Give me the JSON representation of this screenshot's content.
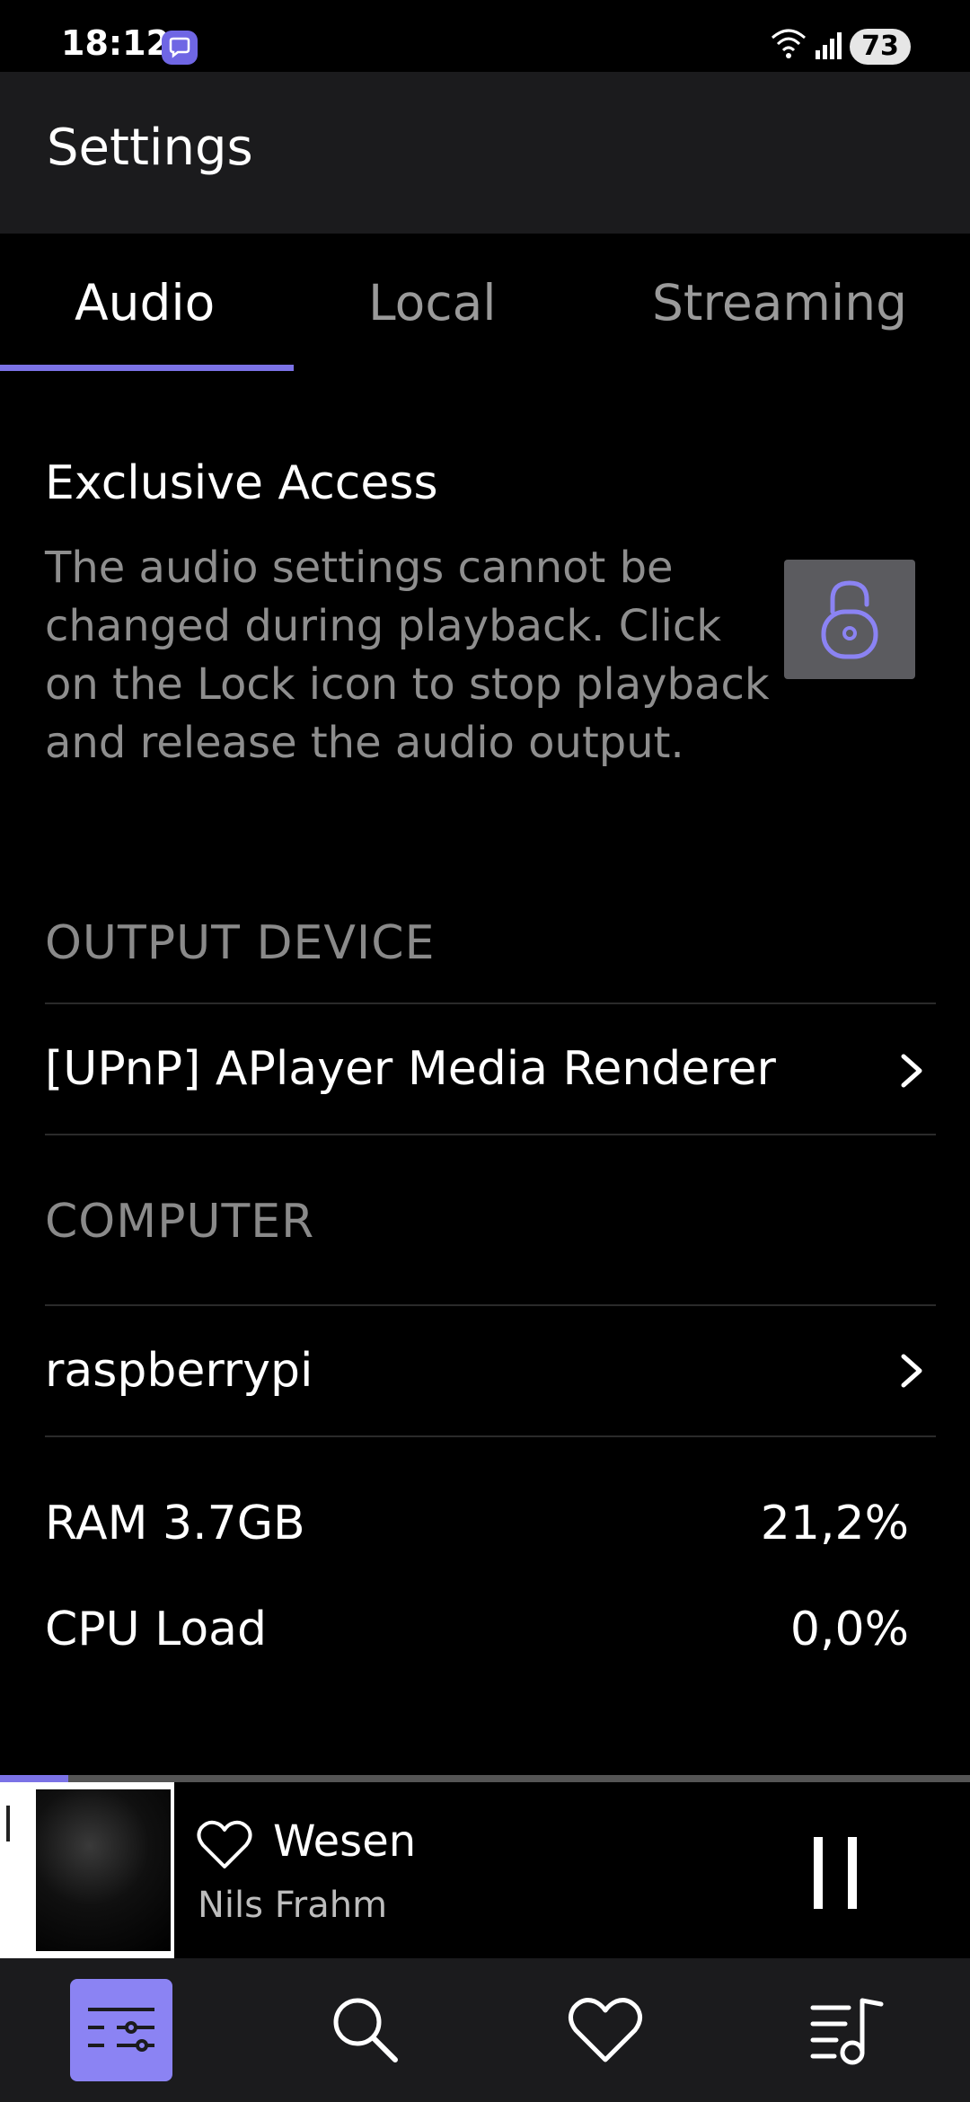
{
  "status_bar": {
    "time": "18:12",
    "battery": "73"
  },
  "header": {
    "title": "Settings"
  },
  "tabs": [
    {
      "label": "Audio",
      "active": true
    },
    {
      "label": "Local",
      "active": false
    },
    {
      "label": "Streaming",
      "active": false
    }
  ],
  "exclusive_access": {
    "title": "Exclusive Access",
    "description": "The audio settings cannot be changed during playback. Click on the Lock icon to stop playback and release the audio output."
  },
  "output_device": {
    "label": "OUTPUT DEVICE",
    "value": "[UPnP] APlayer Media Renderer"
  },
  "computer": {
    "label": "COMPUTER",
    "value": "raspberrypi"
  },
  "stats": {
    "ram_label": "RAM 3.7GB",
    "ram_value": "21,2%",
    "cpu_label": "CPU Load",
    "cpu_value": "0,0%"
  },
  "player": {
    "title": "Wesen",
    "artist": "Nils Frahm",
    "progress_fraction": 0.07
  },
  "colors": {
    "accent": "#7b72e6",
    "nav_active": "#8b83f3",
    "background": "#000000",
    "header_bg": "#1b1b1d",
    "secondary_text": "#8e8e8e"
  },
  "icons": {
    "notification": "chat-bubble-icon",
    "wifi": "wifi-icon",
    "signal": "signal-icon",
    "lock": "lock-icon",
    "chevron": "chevron-right-icon",
    "favorite": "heart-icon",
    "pause": "pause-icon",
    "nav_settings": "sliders-icon",
    "nav_search": "search-icon",
    "nav_favorites": "heart-icon",
    "nav_queue": "playlist-icon"
  }
}
